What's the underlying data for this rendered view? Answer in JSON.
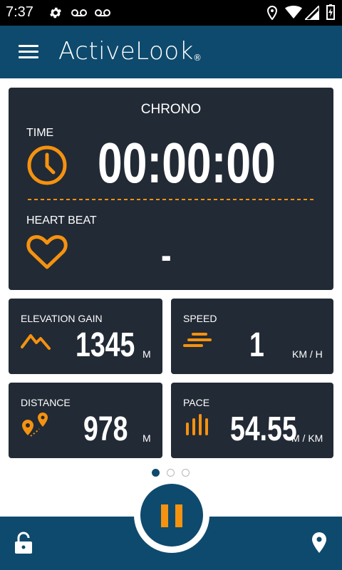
{
  "status_bar": {
    "time": "7:37"
  },
  "app_bar": {
    "brand": "ActiveLook",
    "brand_mark": "®"
  },
  "chrono_card": {
    "title": "CHRONO",
    "time_label": "TIME",
    "time_value": "00:00:00",
    "heart_label": "HEART BEAT",
    "heart_value": "-"
  },
  "metrics": {
    "elevation": {
      "label": "ELEVATION GAIN",
      "value": "1345",
      "unit": "M"
    },
    "speed": {
      "label": "SPEED",
      "value": "1",
      "unit": "KM / H"
    },
    "distance": {
      "label": "DISTANCE",
      "value": "978",
      "unit": "M"
    },
    "pace": {
      "label": "PACE",
      "value": "54.55",
      "unit": "M / KM"
    }
  },
  "page_indicator": {
    "count": 3,
    "active": 1
  },
  "colors": {
    "accent": "#f5920f",
    "brand": "#0e4a6d",
    "card": "#222a35"
  },
  "icons": {
    "status": [
      "settings-icon",
      "voicemail-icon",
      "voicemail-icon",
      "location-icon",
      "wifi-icon",
      "signal-icon",
      "battery-charging-icon"
    ],
    "cards": [
      "clock-icon",
      "heart-icon",
      "mountain-icon",
      "speed-lines-icon",
      "route-pin-icon",
      "pace-bars-icon"
    ],
    "bottom": [
      "lock-icon",
      "pause-icon",
      "map-pin-icon"
    ]
  }
}
